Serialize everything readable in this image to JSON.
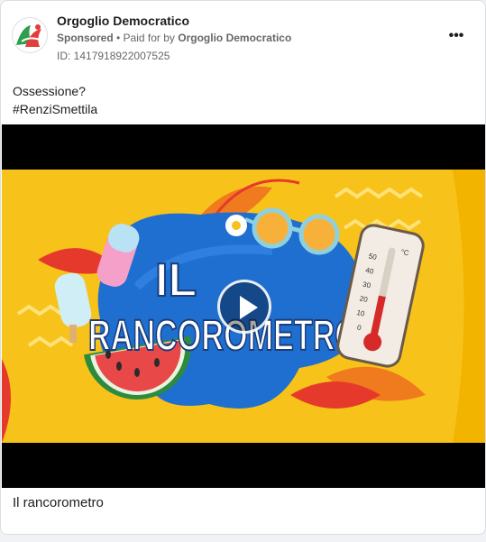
{
  "post": {
    "page_name": "Orgoglio Democratico",
    "sponsored_label": "Sponsored",
    "paid_for_prefix": "• Paid for by",
    "paid_for_name": "Orgoglio Democratico",
    "ad_id": "ID: 1417918922007525",
    "more_icon": "more-horizontal-icon",
    "body_lines": [
      "Ossessione?",
      "#RenziSmettila"
    ],
    "caption": "Il rancorometro"
  },
  "video": {
    "title_line1": "IL",
    "title_line2": "RANCOROMETRO",
    "thermometer_labels": [
      "°C",
      "50",
      "40",
      "30",
      "20",
      "10",
      "0"
    ],
    "play_icon": "play-icon",
    "colors": {
      "background": "#f7c21a",
      "blob": "#1f6fd1",
      "red_accent": "#e53a2b",
      "orange_leaf": "#f07a1e"
    }
  },
  "colors": {
    "card_bg": "#ffffff",
    "border": "#dadde1",
    "secondary_text": "#65676b"
  }
}
